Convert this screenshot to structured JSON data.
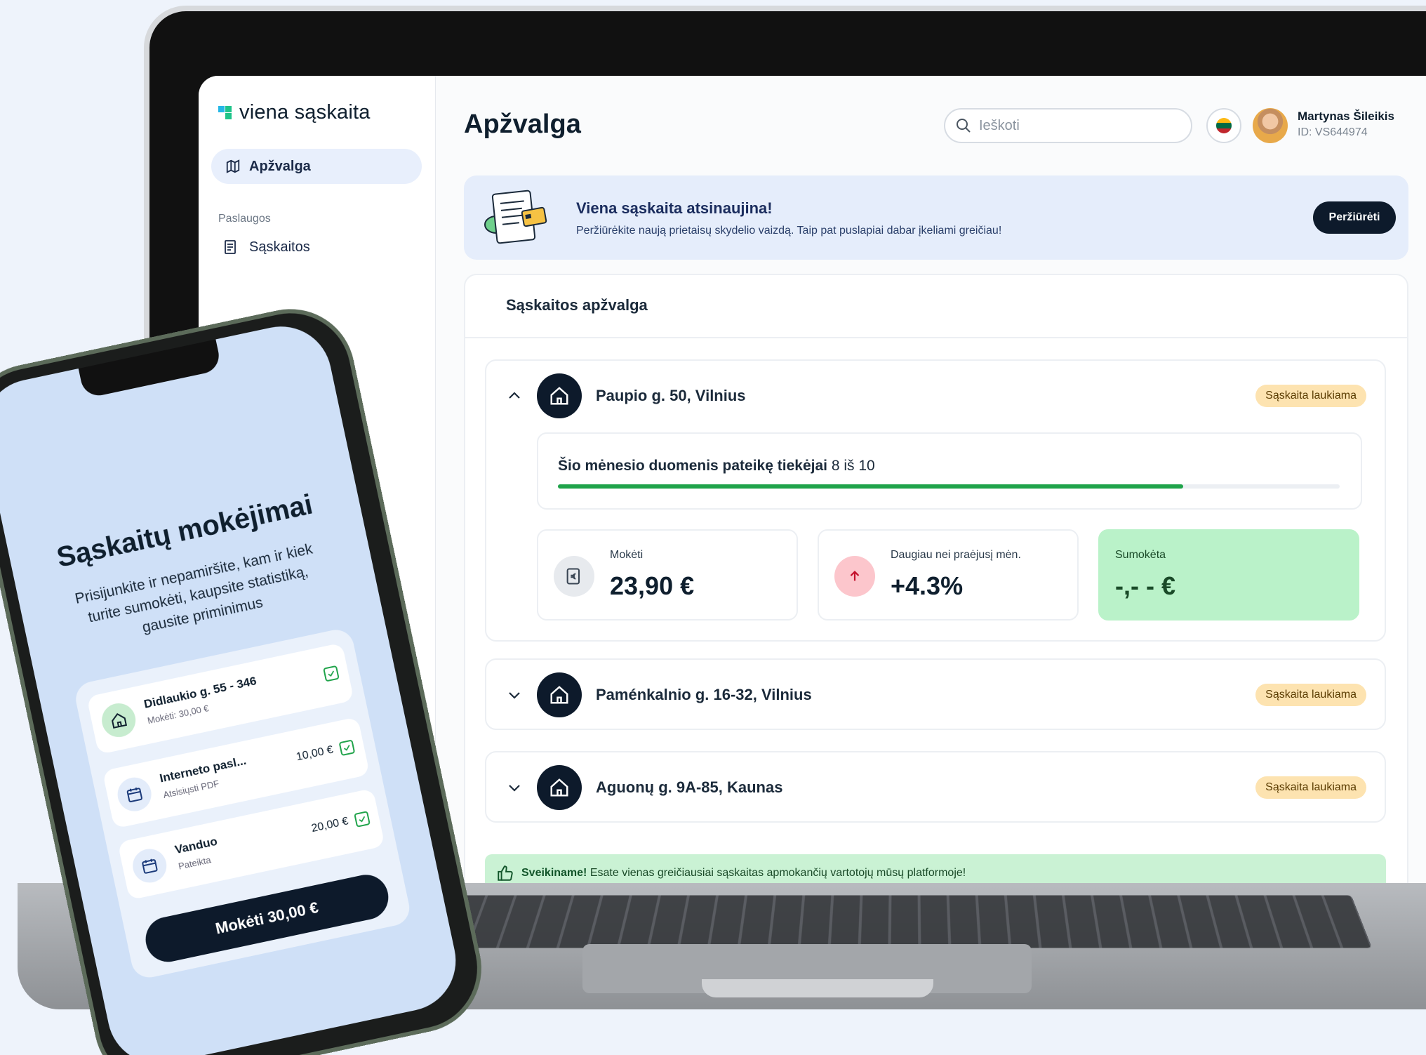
{
  "app": {
    "logo_text": "viena sąskaita",
    "page_title": "Apžvalga"
  },
  "sidebar": {
    "active_item": "Apžvalga",
    "section_label": "Paslaugos",
    "items": [
      {
        "label": "Sąskaitos",
        "icon": "invoice-icon"
      }
    ]
  },
  "header": {
    "search_placeholder": "Ieškoti",
    "language_flag": "lithuania-flag-icon",
    "user_name": "Martynas Šileikis",
    "user_id": "ID: VS644974"
  },
  "banner": {
    "title": "Viena sąskaita atsinaujina!",
    "text": "Peržiūrėkite naują prietaisų skydelio vaizdą. Taip pat puslapiai dabar įkeliami greičiau!",
    "button": "Peržiūrėti"
  },
  "overview": {
    "title": "Sąskaitos apžvalga",
    "properties": [
      {
        "address": "Paupio g. 50, Vilnius",
        "status": "Sąskaita laukiama",
        "expanded": true,
        "progress_label": "Šio mėnesio duomenis pateikę tiekėjai",
        "progress_count": "8 iš 10",
        "progress_fraction": 0.8,
        "stats": [
          {
            "label": "Mokėti",
            "value": "23,90 €"
          },
          {
            "label": "Daugiau nei praėjusį mėn.",
            "value": "+4.3%"
          },
          {
            "label": "Sumokėta",
            "value": "-,- - €"
          }
        ]
      },
      {
        "address": "Paménkalnio g. 16-32, Vilnius",
        "status": "Sąskaita laukiama",
        "expanded": false
      },
      {
        "address": "Aguonų g. 9A-85, Kaunas",
        "status": "Sąskaita laukiama",
        "expanded": false
      }
    ],
    "congrats_bold": "Sveikiname!",
    "congrats_text": "Esate vienas greičiausiai sąskaitas apmokančių vartotojų mūsų platformoje!"
  },
  "phone": {
    "title": "Sąskaitų mokėjimai",
    "text": "Prisijunkite ir nepamiršite, kam ir kiek turite sumokėti, kaupsite statistiką, gausite priminimus",
    "rows": [
      {
        "title": "Didlaukio g. 55 - 346",
        "subtitle": "Mokėti: 30,00 €",
        "amount": ""
      },
      {
        "title": "Interneto pasl...",
        "subtitle": "Atsisiųsti PDF",
        "amount": "10,00 €"
      },
      {
        "title": "Vanduo",
        "subtitle": "Pateikta",
        "amount": "20,00 €"
      }
    ],
    "pay_button": "Mokėti 30,00 €"
  },
  "colors": {
    "accent_dark": "#0d1a2b",
    "progress_green": "#1fa34a",
    "status_badge": "#fde3b0",
    "paid_green": "#baf2c9",
    "banner_blue": "#e5edfb"
  }
}
